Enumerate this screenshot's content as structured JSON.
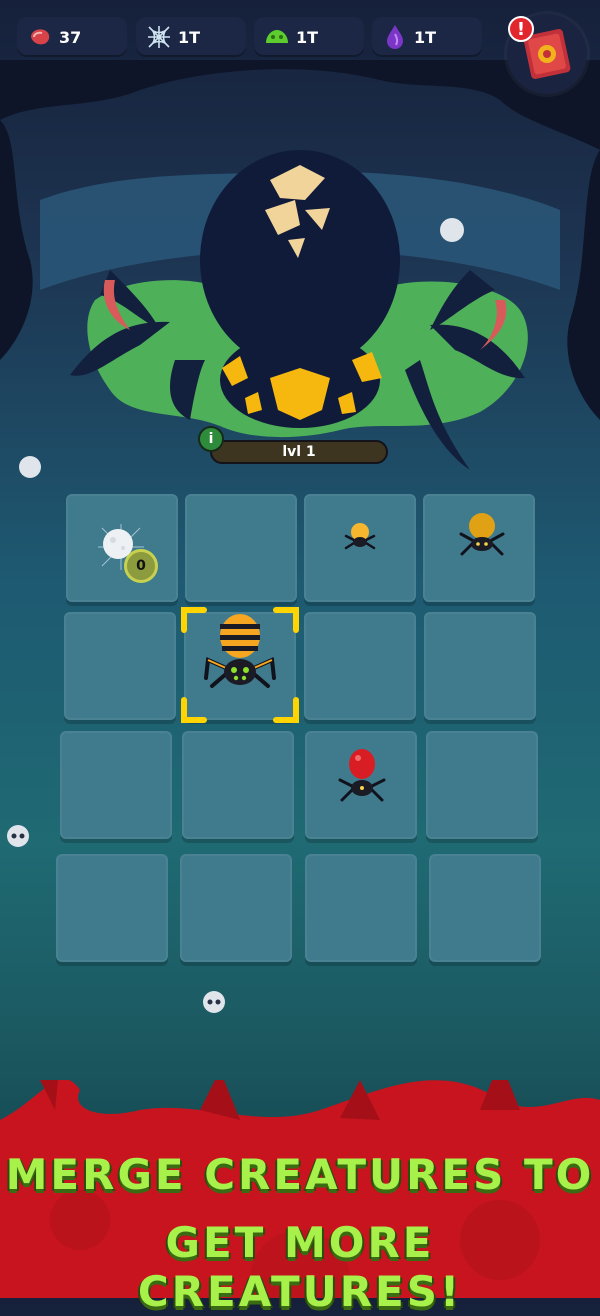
{
  "resources": [
    {
      "icon": "meat-icon",
      "value": "37"
    },
    {
      "icon": "cobweb-icon",
      "value": "1T"
    },
    {
      "icon": "slime-icon",
      "value": "1T"
    },
    {
      "icon": "dark-essence-icon",
      "value": "1T"
    }
  ],
  "book": {
    "alert_glyph": "!"
  },
  "boss": {
    "level_label": "lvl 1",
    "info_glyph": "i"
  },
  "egg": {
    "counter": "0"
  },
  "banner": {
    "line1": "MERGE CREATURES TO",
    "line2": "GET MORE CREATURES!"
  },
  "colors": {
    "banner_red": "#c8141e",
    "banner_text": "#a8f04a",
    "tile": "#3f7b8d",
    "selection": "#ffd400"
  }
}
